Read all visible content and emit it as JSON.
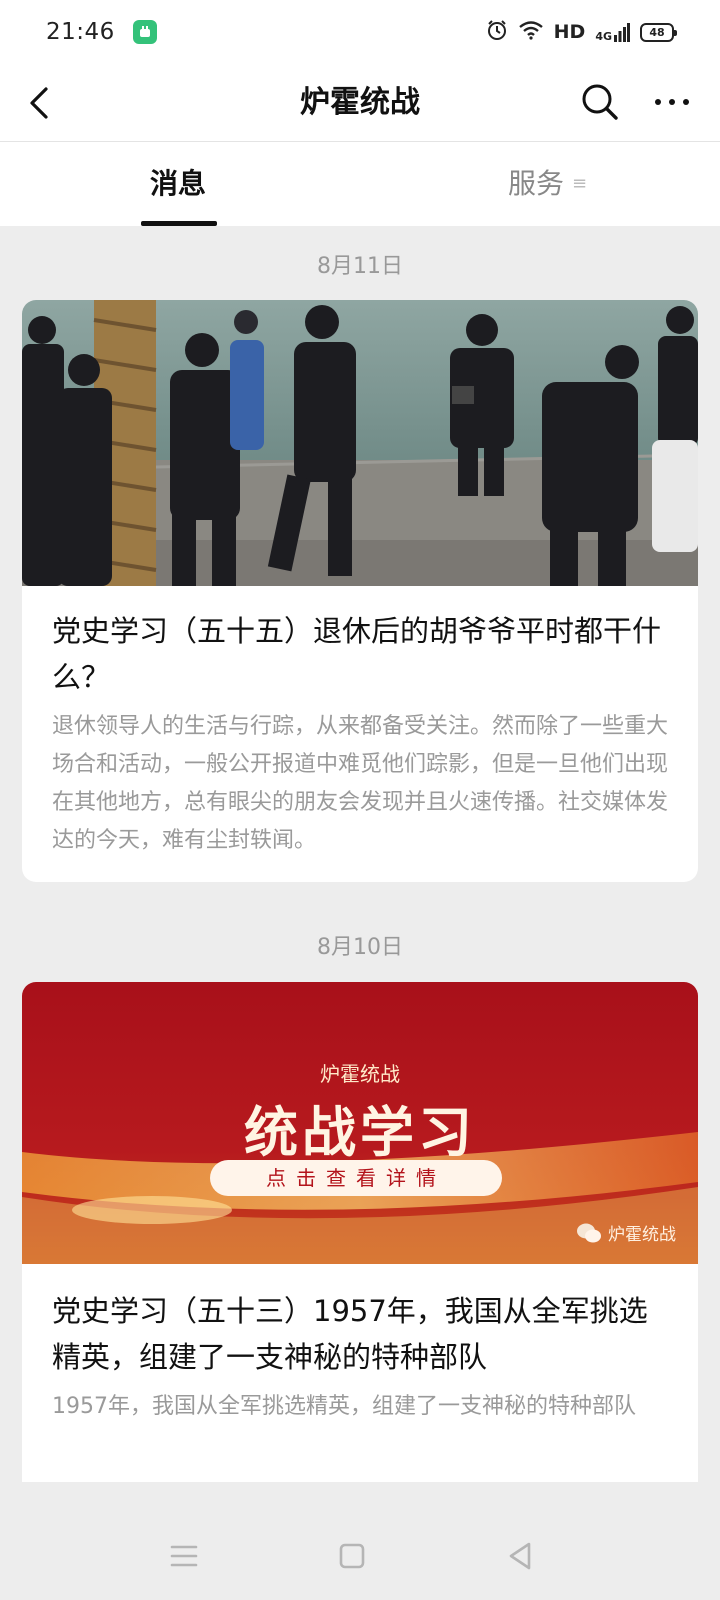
{
  "status_bar": {
    "time": "21:46",
    "network": "HD",
    "signal": "4G",
    "battery": "48"
  },
  "nav": {
    "title": "炉霍统战"
  },
  "tabs": [
    {
      "label": "消息",
      "active": true
    },
    {
      "label": "服务",
      "active": false
    }
  ],
  "feed": [
    {
      "date": "8月11日",
      "title": "党史学习（五十五）退休后的胡爷爷平时都干什么？",
      "description": "退休领导人的生活与行踪，从来都备受关注。然而除了一些重大场合和活动，一般公开报道中难觅他们踪影，但是一旦他们出现在其他地方，总有眼尖的朋友会发现并且火速传播。社交媒体发达的今天，难有尘封轶闻。"
    },
    {
      "date": "8月10日",
      "banner": {
        "account": "炉霍统战",
        "headline": "统战学习",
        "button": "点击查看详情",
        "watermark": "炉霍统战"
      },
      "title": "党史学习（五十三）1957年，我国从全军挑选精英，组建了一支神秘的特种部队",
      "description": "1957年，我国从全军挑选精英，组建了一支神秘的特种部队"
    }
  ],
  "colors": {
    "background": "#ededed",
    "banner_red": "#b3131b",
    "accent_green": "#34c27a"
  }
}
